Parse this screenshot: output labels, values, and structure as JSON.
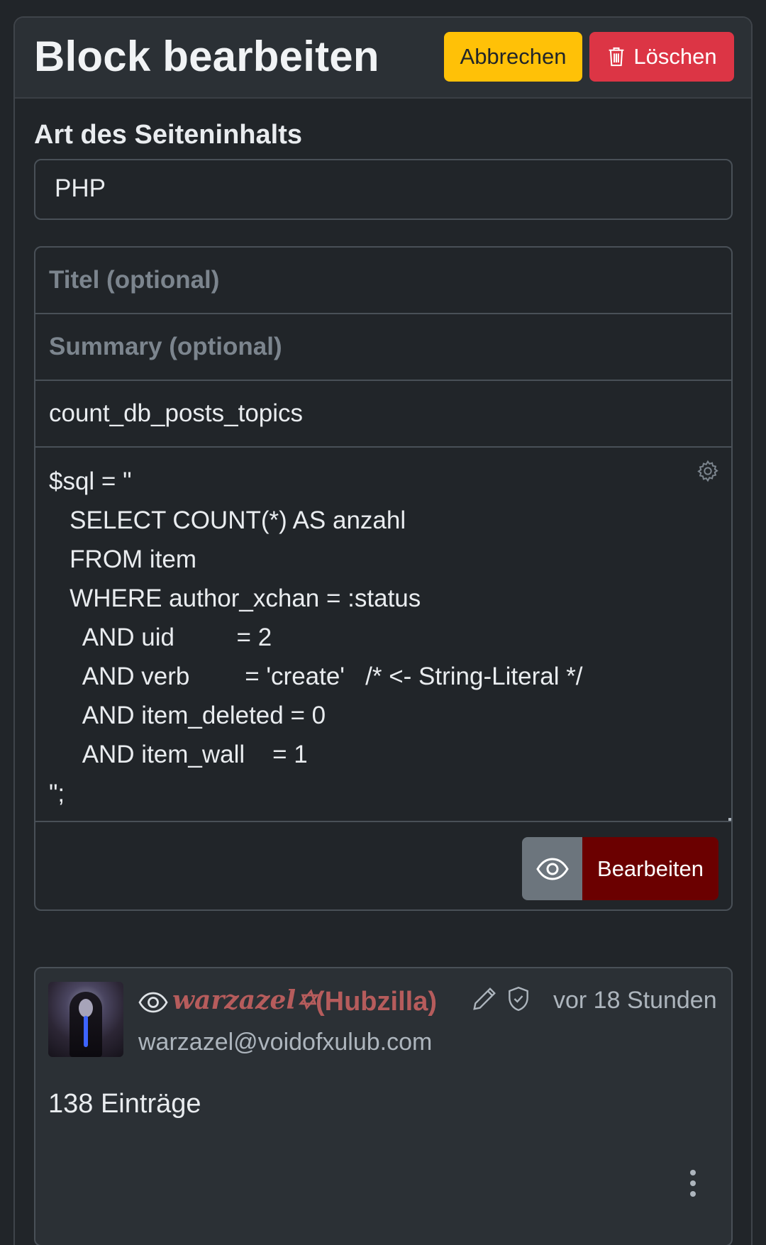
{
  "header": {
    "title": "Block bearbeiten",
    "cancel_label": "Abbrechen",
    "delete_label": "Löschen",
    "delete_icon": "trash-icon"
  },
  "content_type": {
    "label": "Art des Seiteninhalts",
    "selected": "PHP"
  },
  "form": {
    "title_placeholder": "Titel (optional)",
    "summary_placeholder": "Summary (optional)",
    "name_value": "count_db_posts_topics",
    "code_lines": [
      "$sql = \"",
      "   SELECT COUNT(*) AS anzahl",
      "   FROM item",
      "   WHERE author_xchan = :status",
      "     AND uid         = 2",
      "     AND verb        = 'create'   /* <- String-Literal */",
      "     AND item_deleted = 0",
      "     AND item_wall    = 1",
      "\";"
    ],
    "settings_icon": "gear-icon",
    "preview_icon": "eye-icon",
    "edit_label": "Bearbeiten"
  },
  "post": {
    "author_name": "warzazel✡",
    "author_network": "(Hubzilla)",
    "author_address": "warzazel@voidofxulub.com",
    "time": "vor 18 Stunden",
    "body": "138 Einträge",
    "icons": [
      "eye-icon",
      "pencil-icon",
      "shield-check-icon",
      "more-vertical-icon"
    ]
  },
  "colors": {
    "background": "#212529",
    "header_bg": "#2b3035",
    "warning": "#ffc107",
    "danger": "#dc3545",
    "edit_button": "#6b0000",
    "secondary": "#6c757d",
    "author": "#b65c5c"
  }
}
